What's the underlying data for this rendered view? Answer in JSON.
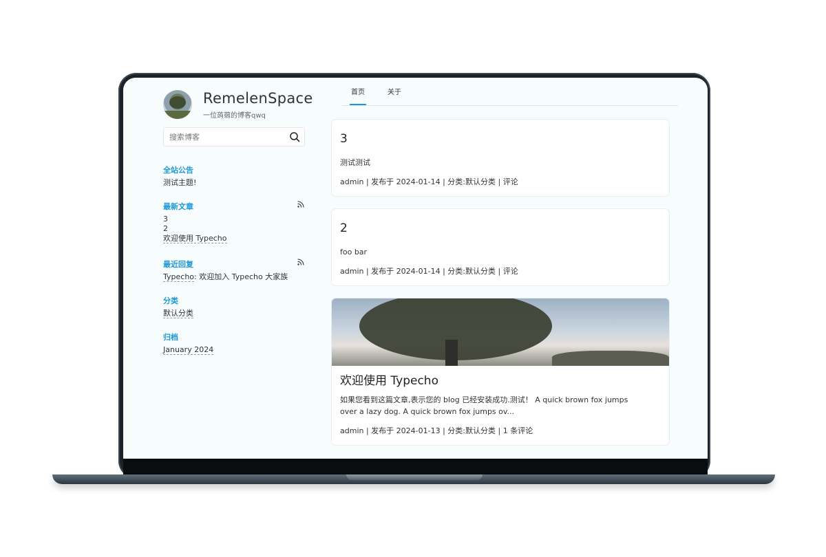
{
  "site": {
    "title": "RemelenSpace",
    "description": "一位蒟蒻的博客qwq"
  },
  "search": {
    "placeholder": "搜索博客"
  },
  "nav": {
    "tabs": [
      {
        "label": "首页",
        "active": true
      },
      {
        "label": "关于",
        "active": false
      }
    ]
  },
  "sidebar": {
    "announcement": {
      "title": "全站公告",
      "text": "测试主题!"
    },
    "recent_posts": {
      "title": "最新文章",
      "items": [
        "3",
        "2",
        "欢迎使用 Typecho"
      ]
    },
    "recent_comments": {
      "title": "最近回复",
      "author": "Typecho",
      "text": ": 欢迎加入 Typecho 大家族"
    },
    "categories": {
      "title": "分类",
      "items": [
        "默认分类"
      ]
    },
    "archives": {
      "title": "归档",
      "items": [
        "January 2024"
      ]
    }
  },
  "posts": [
    {
      "title": "3",
      "excerpt": "测试测试",
      "meta": "admin | 发布于 2024-01-14 | 分类:默认分类 | 评论"
    },
    {
      "title": "2",
      "excerpt": "foo bar",
      "meta": "admin | 发布于 2024-01-14 | 分类:默认分类 | 评论"
    },
    {
      "title": "欢迎使用 Typecho",
      "excerpt_line1": "如果您看到这篇文章,表示您的 blog 已经安装成功.测试！ A quick brown fox jumps",
      "excerpt_line2": "over a lazy dog. A quick brown fox jumps ov...",
      "meta": "admin | 发布于 2024-01-13 | 分类:默认分类 | 1 条评论"
    }
  ],
  "colors": {
    "accent": "#1e98d7",
    "screen_bg": "#f7fcfd",
    "frame": "#1c2228"
  }
}
